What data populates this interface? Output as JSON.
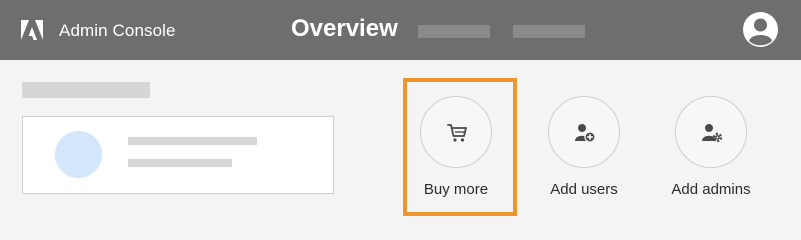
{
  "header": {
    "app_title": "Admin Console",
    "page_title": "Overview",
    "logo_icon": "adobe-logo-icon",
    "avatar_icon": "user-avatar-icon"
  },
  "actions": [
    {
      "label": "Buy more",
      "icon": "shopping-cart-icon"
    },
    {
      "label": "Add users",
      "icon": "add-user-icon"
    },
    {
      "label": "Add admins",
      "icon": "admin-settings-icon"
    }
  ],
  "colors": {
    "header_bg": "#6e6e6e",
    "highlight": "#f0952b",
    "org_avatar": "#d4e6fb",
    "placeholder": "#d6d6d6"
  }
}
